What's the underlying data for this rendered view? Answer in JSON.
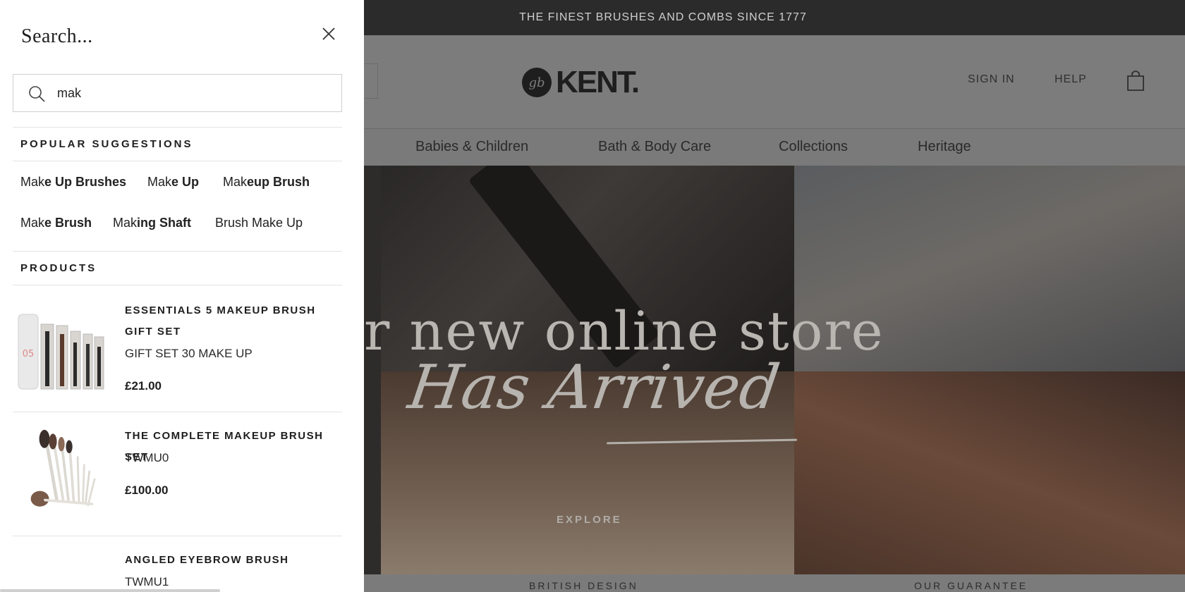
{
  "announcement": "THE FINEST BRUSHES AND COMBS SINCE 1777",
  "brand": {
    "logo_mark": "gb",
    "logo_text": "KENT."
  },
  "header": {
    "sign_in": "SIGN IN",
    "help": "HELP"
  },
  "nav": [
    "Babies & Children",
    "Bath & Body Care",
    "Collections",
    "Heritage"
  ],
  "hero": {
    "line1": "r new online store",
    "line2": "Has Arrived",
    "cta": "EXPLORE"
  },
  "footer_strip": [
    "BRITISH DESIGN",
    "OUR GUARANTEE"
  ],
  "search": {
    "title": "Search...",
    "query": "mak",
    "popular_title": "POPULAR SUGGESTIONS",
    "suggestions": [
      {
        "prefix": "Mak",
        "rest": "e Up Brushes"
      },
      {
        "prefix": "Mak",
        "rest": "e Up"
      },
      {
        "prefix": "Mak",
        "rest": "eup Brush"
      },
      {
        "prefix": "Mak",
        "rest": "e Brush"
      },
      {
        "prefix": "Mak",
        "rest": "ing Shaft"
      },
      {
        "prefix": "Brush Make Up",
        "rest": ""
      }
    ],
    "products_title": "PRODUCTS",
    "products": [
      {
        "name": "ESSENTIALS 5 MAKEUP BRUSH GIFT SET",
        "sku": "GIFT SET 30 MAKE UP",
        "price": "£21.00",
        "thumb_text": "05"
      },
      {
        "name": "THE COMPLETE MAKEUP BRUSH SET",
        "sku": "TWMU0",
        "price": "£100.00"
      },
      {
        "name": "ANGLED EYEBROW BRUSH",
        "sku": "TWMU1"
      }
    ]
  }
}
